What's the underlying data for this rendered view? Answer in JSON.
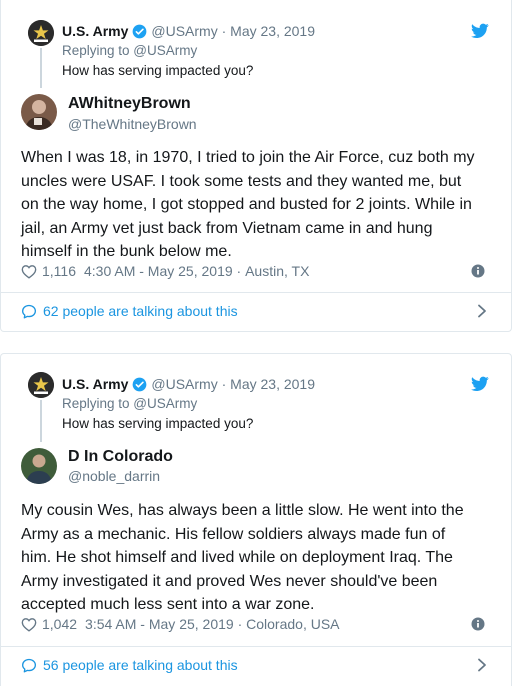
{
  "colors": {
    "accent": "#1da1f2",
    "link": "#1b95e0",
    "muted": "#657786",
    "text": "#14171a",
    "border": "#e1e8ed"
  },
  "tweets": [
    {
      "parent": {
        "name": "U.S. Army",
        "handle": "@USArmy",
        "date": "May 23, 2019",
        "replying_prefix": "Replying to ",
        "replying_handle": "@USArmy",
        "text": "How has serving impacted you?",
        "icons": [
          "army-star-icon",
          "verified-icon",
          "twitter-bird-icon"
        ]
      },
      "reply": {
        "name": "AWhitneyBrown",
        "handle": "@TheWhitneyBrown",
        "text_lines": [
          "When I was 18, in 1970, I tried to join the Air Force, cuz both my",
          "uncles were USAF. I took some tests and they wanted me, but",
          "on the way home, I got stopped and busted for 2 joints. While in",
          "jail, an Army vet just back from Vietnam came in and hung",
          "himself in the bunk below me."
        ],
        "likes": "1,116",
        "time": "4:30 AM - May 25, 2019",
        "location": "Austin, TX",
        "talking": "62 people are talking about this"
      }
    },
    {
      "parent": {
        "name": "U.S. Army",
        "handle": "@USArmy",
        "date": "May 23, 2019",
        "replying_prefix": "Replying to ",
        "replying_handle": "@USArmy",
        "text": "How has serving impacted you?",
        "icons": [
          "army-star-icon",
          "verified-icon",
          "twitter-bird-icon"
        ]
      },
      "reply": {
        "name": "D In Colorado",
        "handle": "@noble_darrin",
        "text_lines": [
          "My cousin Wes, has always been a little slow. He went into the",
          "Army as a mechanic. His fellow soldiers always made fun of",
          "him. He shot himself and lived while on deployment Iraq. The",
          "Army investigated it and proved Wes never should've been",
          "accepted much less sent into a war zone."
        ],
        "likes": "1,042",
        "time": "3:54 AM - May 25, 2019",
        "location": "Colorado, USA",
        "talking": "56 people are talking about this"
      }
    }
  ]
}
